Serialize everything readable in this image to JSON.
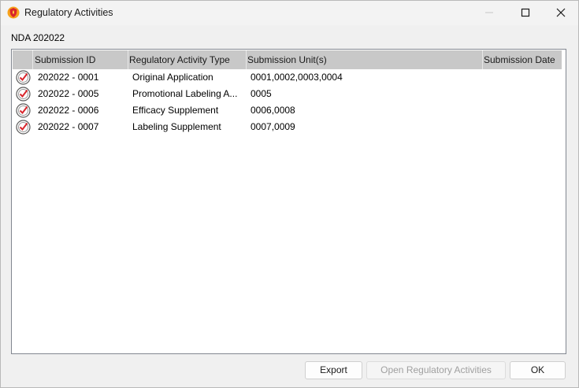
{
  "window": {
    "title": "Regulatory Activities",
    "app_icon": "shield-flame-icon",
    "controls": [
      "minimize-icon",
      "maximize-icon",
      "close-icon"
    ]
  },
  "caption": "NDA 202022",
  "table": {
    "columns": [
      "Submission ID",
      "Regulatory Activity Type",
      "Submission Unit(s)",
      "Submission Date"
    ],
    "rows": [
      {
        "icon": "check-document-icon",
        "submission_id": "202022 - 0001",
        "activity_type": "Original Application",
        "units": "0001,0002,0003,0004",
        "date": ""
      },
      {
        "icon": "check-document-icon",
        "submission_id": "202022 - 0005",
        "activity_type": "Promotional Labeling A...",
        "units": "0005",
        "date": ""
      },
      {
        "icon": "check-document-icon",
        "submission_id": "202022 - 0006",
        "activity_type": "Efficacy Supplement",
        "units": "0006,0008",
        "date": ""
      },
      {
        "icon": "check-document-icon",
        "submission_id": "202022 - 0007",
        "activity_type": "Labeling Supplement",
        "units": "0007,0009",
        "date": ""
      }
    ]
  },
  "buttons": {
    "export": "Export",
    "open_activities": "Open Regulatory Activities",
    "ok": "OK"
  },
  "colors": {
    "header_bg": "#c8c8c8",
    "accent_red": "#d9262c",
    "icon_orange": "#f0a020"
  }
}
